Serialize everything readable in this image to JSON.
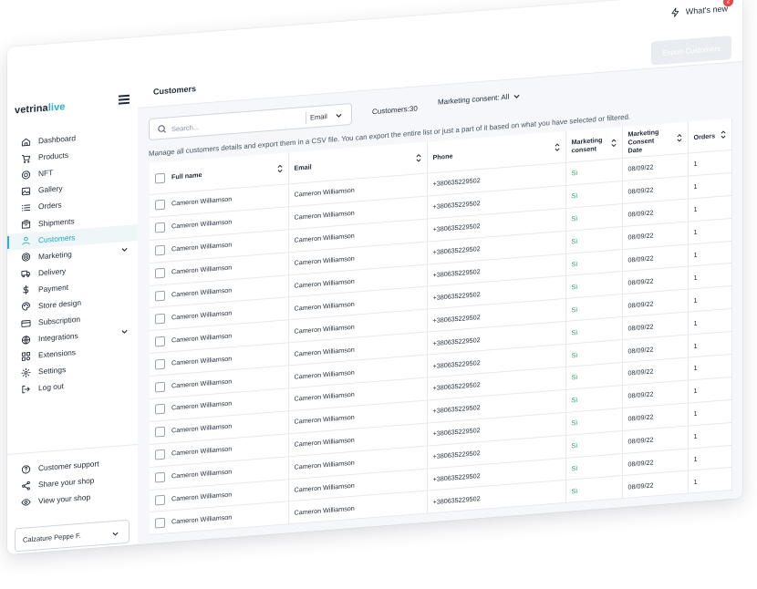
{
  "topbar": {
    "whats_new": "What's new",
    "notifications": "2"
  },
  "brand": {
    "part1": "vetrina",
    "part2": "live"
  },
  "sidebar": {
    "items": [
      {
        "label": "Dashboard",
        "icon": "dashboard-icon"
      },
      {
        "label": "Products",
        "icon": "cart-icon"
      },
      {
        "label": "NFT",
        "icon": "nft-icon"
      },
      {
        "label": "Gallery",
        "icon": "image-icon"
      },
      {
        "label": "Orders",
        "icon": "list-icon"
      },
      {
        "label": "Shipments",
        "icon": "box-icon"
      },
      {
        "label": "Customers",
        "icon": "user-icon",
        "active": true
      },
      {
        "label": "Marketing",
        "icon": "target-icon",
        "expandable": true
      },
      {
        "label": "Delivery",
        "icon": "truck-icon"
      },
      {
        "label": "Payment",
        "icon": "dollar-icon"
      },
      {
        "label": "Store design",
        "icon": "palette-icon"
      },
      {
        "label": "Subscription",
        "icon": "card-icon"
      },
      {
        "label": "Integrations",
        "icon": "globe-icon",
        "expandable": true
      },
      {
        "label": "Extensions",
        "icon": "puzzle-icon"
      },
      {
        "label": "Settings",
        "icon": "gear-icon"
      },
      {
        "label": "Log out",
        "icon": "logout-icon"
      }
    ],
    "support": [
      {
        "label": "Customer support",
        "icon": "help-icon"
      },
      {
        "label": "Share your shop",
        "icon": "share-icon"
      },
      {
        "label": "View your shop",
        "icon": "eye-icon"
      }
    ],
    "shop_selector": "Calzature Peppe F."
  },
  "header": {
    "title": "Customers",
    "export_label": "Export Customers"
  },
  "filters": {
    "search_placeholder": "Search...",
    "search_field": "Email",
    "customers_count": "Customers:30",
    "marketing_consent": "Marketing consent: All"
  },
  "description": "Manage all customers details and export them in a CSV file. You can export the entire list or just a part of it based on what you have selected or filtered.",
  "table": {
    "columns": [
      "Full name",
      "Email",
      "Phone",
      "Marketing consent",
      "Marketing Consent Date",
      "Orders"
    ],
    "rows": [
      [
        "Cameron Williamson",
        "Cameron Williamson",
        "+380635229502",
        "Sì",
        "08/09/22",
        "1"
      ],
      [
        "Cameron Williamson",
        "Cameron Williamson",
        "+380635229502",
        "Sì",
        "08/09/22",
        "1"
      ],
      [
        "Cameron Williamson",
        "Cameron Williamson",
        "+380635229502",
        "Sì",
        "08/09/22",
        "1"
      ],
      [
        "Cameron Williamson",
        "Cameron Williamson",
        "+380635229502",
        "Sì",
        "08/09/22",
        "1"
      ],
      [
        "Cameron Williamson",
        "Cameron Williamson",
        "+380635229502",
        "Sì",
        "08/09/22",
        "1"
      ],
      [
        "Cameron Williamson",
        "Cameron Williamson",
        "+380635229502",
        "Sì",
        "08/09/22",
        "1"
      ],
      [
        "Cameron Williamson",
        "Cameron Williamson",
        "+380635229502",
        "Sì",
        "08/09/22",
        "1"
      ],
      [
        "Cameron Williamson",
        "Cameron Williamson",
        "+380635229502",
        "Sì",
        "08/09/22",
        "1"
      ],
      [
        "Cameron Williamson",
        "Cameron Williamson",
        "+380635229502",
        "Sì",
        "08/09/22",
        "1"
      ],
      [
        "Cameron Williamson",
        "Cameron Williamson",
        "+380635229502",
        "Sì",
        "08/09/22",
        "1"
      ],
      [
        "Cameron Williamson",
        "Cameron Williamson",
        "+380635229502",
        "Sì",
        "08/09/22",
        "1"
      ],
      [
        "Cameron Williamson",
        "Cameron Williamson",
        "+380635229502",
        "Sì",
        "08/09/22",
        "1"
      ],
      [
        "Cameron Williamson",
        "Cameron Williamson",
        "+380635229502",
        "Sì",
        "08/09/22",
        "1"
      ],
      [
        "Cameron Williamson",
        "Cameron Williamson",
        "+380635229502",
        "Sì",
        "08/09/22",
        "1"
      ],
      [
        "Cameron Williamson",
        "Cameron Williamson",
        "+380635229502",
        "Sì",
        "08/09/22",
        "1"
      ]
    ]
  },
  "colors": {
    "accent": "#2ab0c8",
    "consent_green": "#22a060",
    "badge_red": "#e5484d"
  }
}
